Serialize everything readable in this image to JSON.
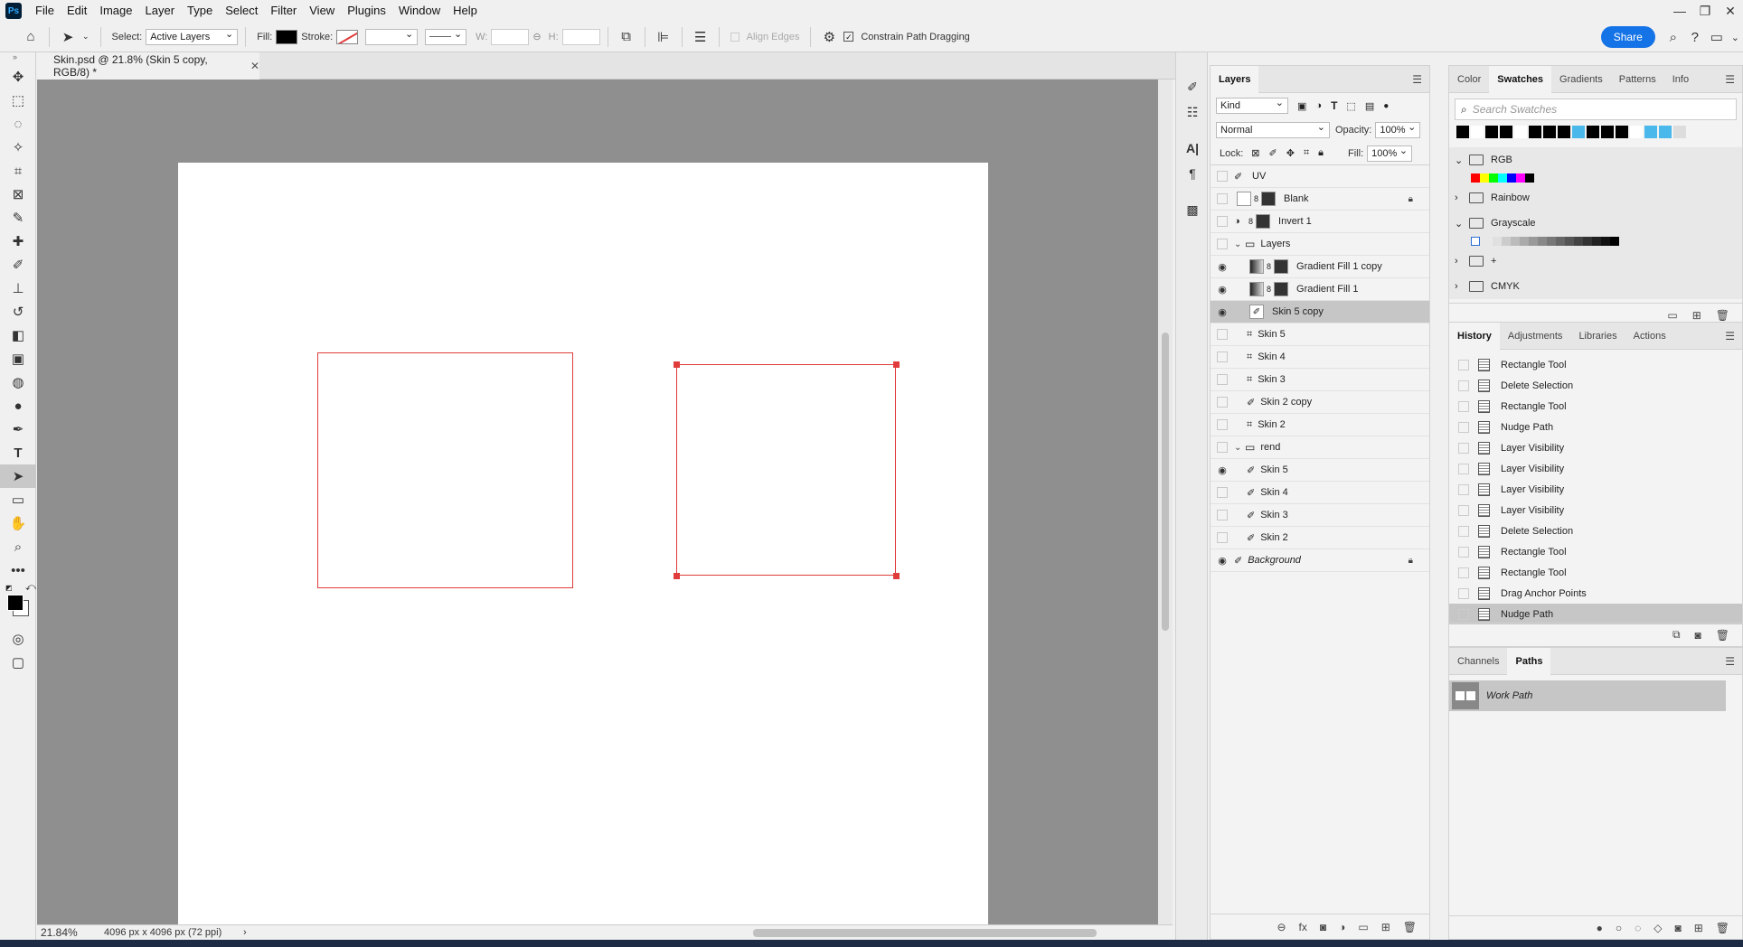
{
  "app": {
    "logo": "Ps",
    "menu": [
      "File",
      "Edit",
      "Image",
      "Layer",
      "Type",
      "Select",
      "Filter",
      "View",
      "Plugins",
      "Window",
      "Help"
    ]
  },
  "options": {
    "select_label": "Select:",
    "select_value": "Active Layers",
    "fill_label": "Fill:",
    "stroke_label": "Stroke:",
    "w_label": "W:",
    "h_label": "H:",
    "align_edges": "Align Edges",
    "constrain_label": "Constrain Path Dragging",
    "share_label": "Share",
    "fill_color": "#000000"
  },
  "document": {
    "tab_title": "Skin.psd @ 21.8% (Skin 5 copy, RGB/8) *"
  },
  "status": {
    "zoom": "21.84%",
    "info": "4096 px x 4096 px (72 ppi)"
  },
  "layers": {
    "tab": "Layers",
    "filter": "Kind",
    "blend_mode": "Normal",
    "opacity_label": "Opacity:",
    "opacity": "100%",
    "lock_label": "Lock:",
    "fill_label": "Fill:",
    "fill": "100%",
    "items": [
      {
        "name": "UV"
      },
      {
        "name": "Blank"
      },
      {
        "name": "Invert 1"
      },
      {
        "name": "Layers"
      },
      {
        "name": "Gradient Fill 1 copy"
      },
      {
        "name": "Gradient Fill 1"
      },
      {
        "name": "Skin 5 copy"
      },
      {
        "name": "Skin 5"
      },
      {
        "name": "Skin 4"
      },
      {
        "name": "Skin 3"
      },
      {
        "name": "Skin 2 copy"
      },
      {
        "name": "Skin 2"
      },
      {
        "name": "rend"
      },
      {
        "name": "Skin 5"
      },
      {
        "name": "Skin 4"
      },
      {
        "name": "Skin 3"
      },
      {
        "name": "Skin 2"
      },
      {
        "name": "Background"
      }
    ]
  },
  "swatches": {
    "tabs": [
      "Color",
      "Swatches",
      "Gradients",
      "Patterns",
      "Info"
    ],
    "search_placeholder": "Search Swatches",
    "groups": [
      "RGB",
      "Rainbow",
      "Grayscale",
      "+",
      "CMYK"
    ]
  },
  "history": {
    "tabs": [
      "History",
      "Adjustments",
      "Libraries",
      "Actions"
    ],
    "items": [
      "Rectangle Tool",
      "Delete Selection",
      "Rectangle Tool",
      "Nudge Path",
      "Layer Visibility",
      "Layer Visibility",
      "Layer Visibility",
      "Layer Visibility",
      "Delete Selection",
      "Rectangle Tool",
      "Rectangle Tool",
      "Drag Anchor Points",
      "Nudge Path"
    ]
  },
  "paths": {
    "tabs": [
      "Channels",
      "Paths"
    ],
    "work_path": "Work Path"
  }
}
